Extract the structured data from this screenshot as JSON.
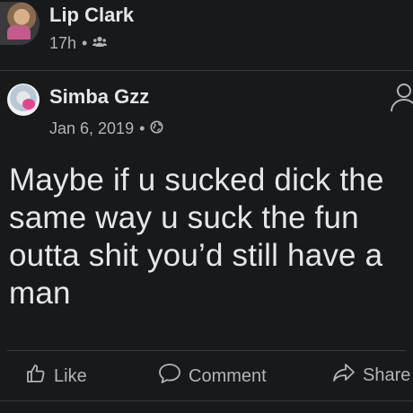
{
  "top_post": {
    "author": "Lip Clark",
    "time": "17h",
    "audience_icon": "group-icon"
  },
  "shared_post": {
    "author": "Simba Gzz",
    "date": "Jan 6, 2019",
    "audience_icon": "globe-icon",
    "text": "Maybe if u sucked dick the same way u suck the fun outta shit you’d still have a man"
  },
  "actions": {
    "like": "Like",
    "comment": "Comment",
    "share": "Share"
  },
  "colors": {
    "background": "#18191a",
    "primary_text": "#e4e6eb",
    "secondary_text": "#b0b3b8",
    "divider": "#3a3b3c"
  }
}
